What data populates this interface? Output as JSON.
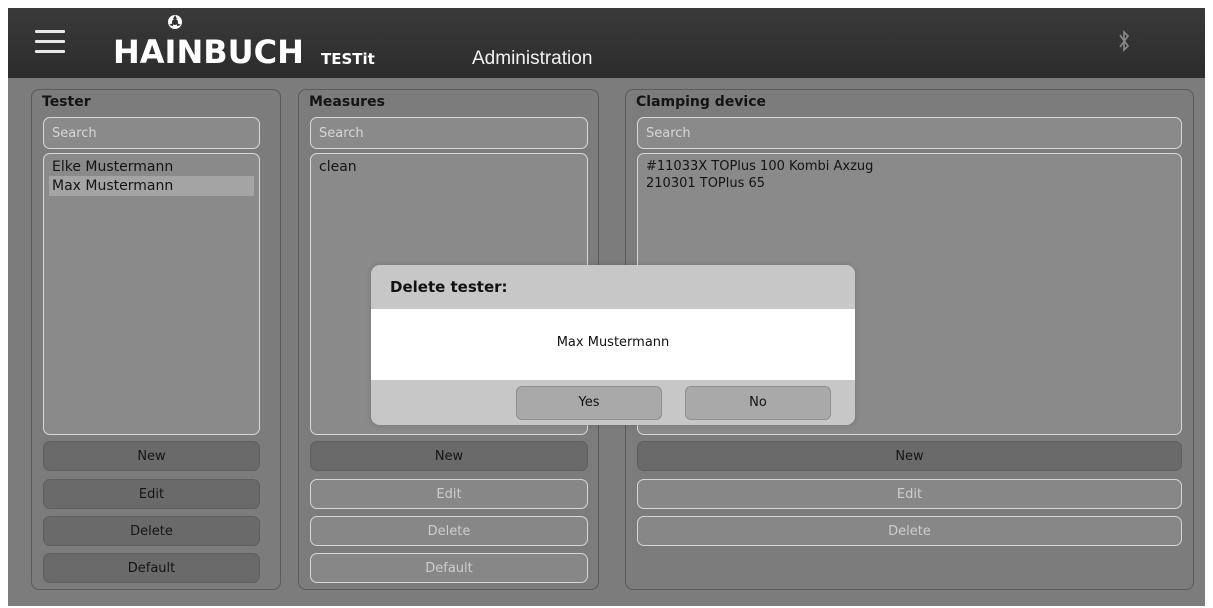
{
  "header": {
    "logo": "HAINBUCH",
    "app_name": "TESTit",
    "page_title": "Administration",
    "icons": [
      "menu-icon",
      "hainbuch-logo-icon",
      "bluetooth-icon"
    ]
  },
  "tester": {
    "title": "Tester",
    "search_placeholder": "Search",
    "items": [
      "Elke Mustermann",
      "Max Mustermann"
    ],
    "selected_index": 1,
    "buttons": {
      "new": "New",
      "edit": "Edit",
      "delete": "Delete",
      "default": "Default"
    }
  },
  "measures": {
    "title": "Measures",
    "search_placeholder": "Search",
    "items": [
      "clean"
    ],
    "buttons": {
      "new": "New",
      "edit": "Edit",
      "delete": "Delete",
      "default": "Default"
    }
  },
  "clamping": {
    "title": "Clamping device",
    "search_placeholder": "Search",
    "items": [
      "#11033X TOPlus 100 Kombi Axzug",
      "210301 TOPlus 65"
    ],
    "buttons": {
      "new": "New",
      "edit": "Edit",
      "delete": "Delete"
    }
  },
  "dialog": {
    "title": "Delete tester:",
    "message": "Max Mustermann",
    "yes": "Yes",
    "no": "No"
  },
  "colors": {
    "background": "#7c7c7c",
    "header": "#2f2f2f",
    "dialog": "#c7c7c7"
  }
}
